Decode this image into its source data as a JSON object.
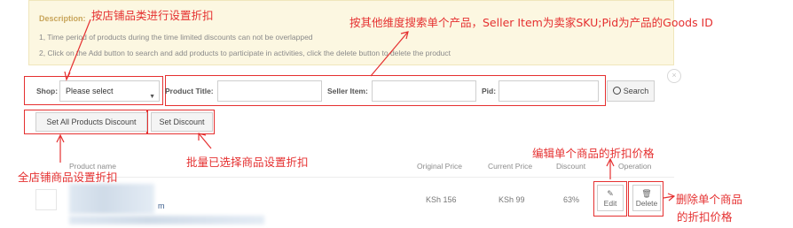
{
  "description": {
    "title": "Description:",
    "line1": "1, Time period of products during the time limited discounts can not be overlapped",
    "line2": "2, Click on the Add button to search and add products to participate in activities, click the delete button to delete the product"
  },
  "filters": {
    "shop_label": "Shop:",
    "shop_value": "Please select",
    "product_title_label": "Product Title:",
    "product_title_value": "",
    "seller_item_label": "Seller Item:",
    "seller_item_value": "",
    "pid_label": "Pid:",
    "pid_value": "",
    "search_label": "Search",
    "close_glyph": "×"
  },
  "actions": {
    "set_all_label": "Set All Products Discount",
    "set_discount_label": "Set Discount"
  },
  "table": {
    "headers": {
      "product_name": "Product name",
      "original_price": "Original Price",
      "current_price": "Current Price",
      "discount": "Discount",
      "operation": "Operation"
    },
    "rows": [
      {
        "name_tail": "m",
        "original_price": "KSh 156",
        "current_price": "KSh 99",
        "discount": "63%",
        "edit_label": "Edit",
        "delete_label": "Delete"
      }
    ]
  },
  "annotations": {
    "shop": "按店铺品类进行设置折扣",
    "search": "按其他维度搜索单个产品，Seller Item为卖家SKU;Pid为产品的Goods ID",
    "all_products": "全店铺商品设置折扣",
    "selected": "批量已选择商品设置折扣",
    "edit": "编辑单个商品的折扣价格",
    "delete_line1": "删除单个商品",
    "delete_line2": "的折扣价格"
  },
  "colors": {
    "annotation_red": "#e53030",
    "description_bg": "#fcf7e1",
    "description_title": "#c8a55a"
  },
  "icons": {
    "search": "search-icon",
    "edit": "edit-icon",
    "delete": "trash-icon",
    "close": "close-icon",
    "dropdown": "chevron-down-icon"
  }
}
